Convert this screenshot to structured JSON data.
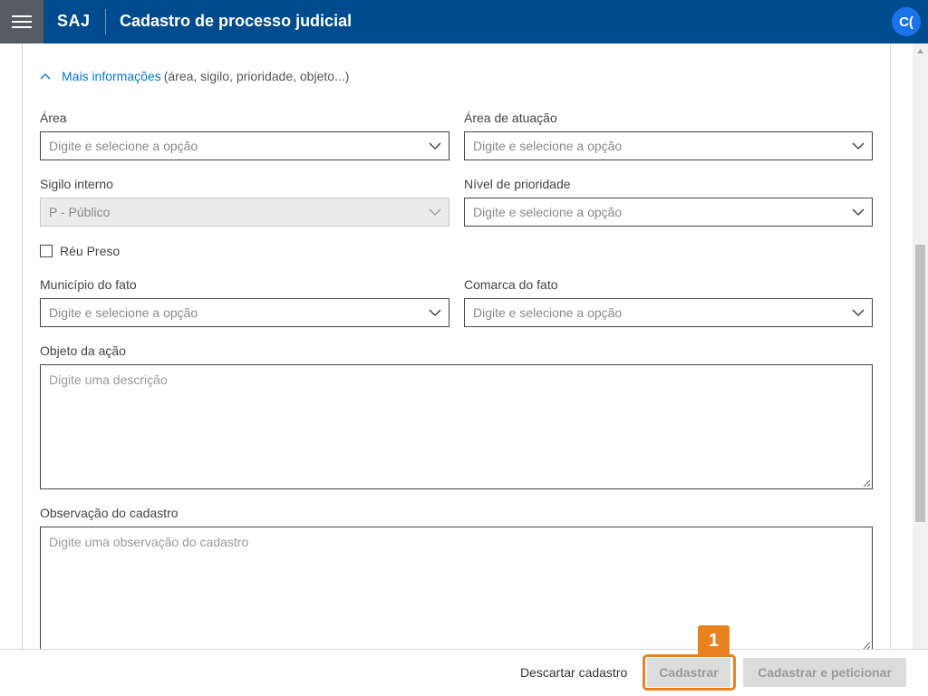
{
  "header": {
    "brand": "SAJ",
    "title": "Cadastro de processo judicial",
    "user_initials": "C("
  },
  "section": {
    "link_label": "Mais informações",
    "hint": "(área, sigilo, prioridade, objeto...)"
  },
  "form": {
    "area": {
      "label": "Área",
      "placeholder": "Digite e selecione a opção"
    },
    "area_atuacao": {
      "label": "Área de atuação",
      "placeholder": "Digite e selecione a opção"
    },
    "sigilo": {
      "label": "Sigilo interno",
      "value": "P - Público"
    },
    "prioridade": {
      "label": "Nível de prioridade",
      "placeholder": "Digite e selecione a opção"
    },
    "reu_preso": {
      "label": "Réu Preso",
      "checked": false
    },
    "municipio": {
      "label": "Município do fato",
      "placeholder": "Digite e selecione a opção"
    },
    "comarca": {
      "label": "Comarca do fato",
      "placeholder": "Digite e selecione a opção"
    },
    "objeto": {
      "label": "Objeto da ação",
      "placeholder": "Digite uma descrição"
    },
    "observacao": {
      "label": "Observação do cadastro",
      "placeholder": "Digite uma observação do cadastro"
    }
  },
  "footer": {
    "discard_label": "Descartar cadastro",
    "submit_label": "Cadastrar",
    "submit_petition_label": "Cadastrar e peticionar"
  },
  "annotation": {
    "step_number": "1",
    "color": "#e8821e"
  },
  "colors": {
    "header_bg": "#004b8d",
    "menu_bg": "#555c63",
    "link": "#0078d4",
    "avatar": "#1a73e8"
  },
  "icons": [
    "menu-icon",
    "chevron-up-icon",
    "chevron-down-icon"
  ]
}
